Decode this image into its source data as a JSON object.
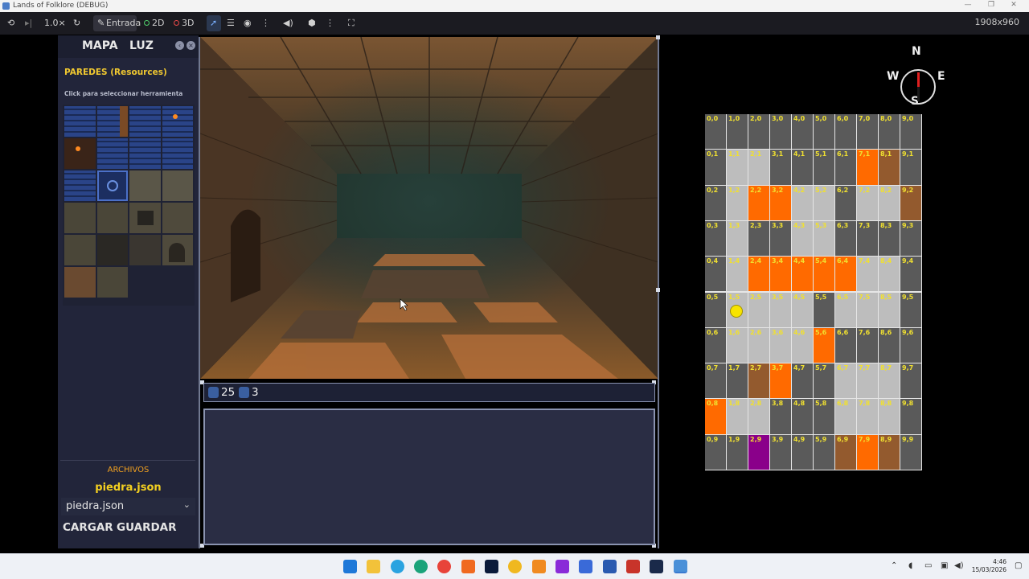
{
  "window": {
    "title": "Lands of Folklore (DEBUG)"
  },
  "toolbar": {
    "zoom": "1.0×",
    "modes": {
      "input": "Entrada",
      "d2": "2D",
      "d3": "3D"
    },
    "resolution": "1908x960"
  },
  "panel": {
    "tabs": [
      "MAPA",
      "LUZ"
    ],
    "section_title": "PAREDES (Resources)",
    "hint": "Click para seleccionar herramienta",
    "files_label": "ARCHIVOS",
    "current_file": "piedra.json",
    "file_select": "piedra.json",
    "load_button": "CARGAR",
    "save_button": "GUARDAR"
  },
  "hud": {
    "gold": "25",
    "keys": "3"
  },
  "compass": {
    "n": "N",
    "s": "S",
    "e": "E",
    "w": "W"
  },
  "colors": {
    "dark": "#5a5a5a",
    "light": "#bdbdbd",
    "orange": "#ff6a00",
    "brown": "#935a2e",
    "purple": "#8a008a",
    "label": "#f0e030"
  },
  "map": {
    "cols": 10,
    "rows": 10,
    "cells": [
      "D",
      "D",
      "D",
      "D",
      "D",
      "D",
      "D",
      "D",
      "D",
      "D",
      "D",
      "L",
      "L",
      "D",
      "D",
      "D",
      "D",
      "O",
      "B",
      "D",
      "D",
      "L",
      "O",
      "O",
      "L",
      "L",
      "D",
      "L",
      "L",
      "B",
      "D",
      "L",
      "D",
      "D",
      "L",
      "L",
      "D",
      "D",
      "D",
      "D",
      "D",
      "L",
      "O",
      "O",
      "O",
      "O",
      "O",
      "L",
      "L",
      "D",
      "D",
      "P",
      "L",
      "L",
      "L",
      "D",
      "L",
      "L",
      "L",
      "D",
      "D",
      "L",
      "L",
      "L",
      "L",
      "O",
      "D",
      "D",
      "D",
      "D",
      "D",
      "D",
      "B",
      "O",
      "D",
      "D",
      "L",
      "L",
      "L",
      "D",
      "O",
      "L",
      "L",
      "D",
      "D",
      "D",
      "L",
      "L",
      "L",
      "D",
      "D",
      "D",
      "U",
      "D",
      "D",
      "D",
      "B",
      "O",
      "B",
      "D"
    ]
  }
}
